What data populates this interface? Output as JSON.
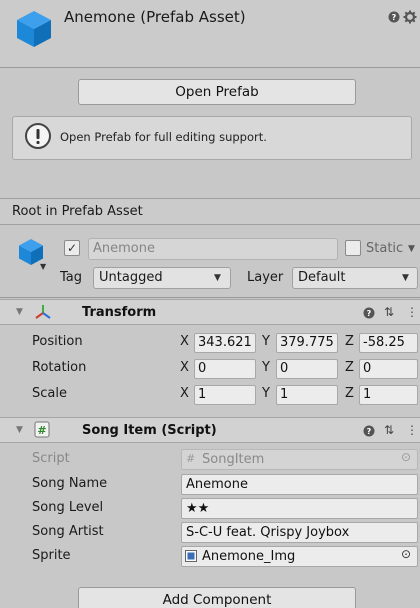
{
  "header": {
    "title": "Anemone (Prefab Asset)",
    "help_icon": "help-icon",
    "settings_icon": "gear-icon"
  },
  "prefab": {
    "open_button": "Open Prefab",
    "help_message": "Open Prefab for full editing support."
  },
  "root": {
    "label": "Root in Prefab Asset"
  },
  "gameobject": {
    "active_check": "✓",
    "name": "Anemone",
    "static_label": "Static",
    "tag_label": "Tag",
    "tag_value": "Untagged",
    "layer_label": "Layer",
    "layer_value": "Default"
  },
  "transform": {
    "title": "Transform",
    "rows": [
      {
        "label": "Position",
        "x": "343.621",
        "y": "379.775",
        "z": "-58.25"
      },
      {
        "label": "Rotation",
        "x": "0",
        "y": "0",
        "z": "0"
      },
      {
        "label": "Scale",
        "x": "1",
        "y": "1",
        "z": "1"
      }
    ],
    "axis": {
      "x": "X",
      "y": "Y",
      "z": "Z"
    }
  },
  "song_item": {
    "title": "Song Item (Script)",
    "script_label": "Script",
    "script_value": "SongItem",
    "fields": [
      {
        "label": "Song Name",
        "value": "Anemone"
      },
      {
        "label": "Song Level",
        "value": "★★"
      },
      {
        "label": "Song Artist",
        "value": "S-C-U feat. Qrispy Joybox"
      }
    ],
    "sprite_label": "Sprite",
    "sprite_value": "Anemone_Img"
  },
  "footer": {
    "add_component": "Add Component"
  },
  "colors": {
    "cube_blue": "#1e88d8",
    "cube_dark": "#0f5e9c",
    "axis_red": "#d23a2a",
    "axis_green": "#3fae3f",
    "axis_blue": "#2e6fd6"
  }
}
